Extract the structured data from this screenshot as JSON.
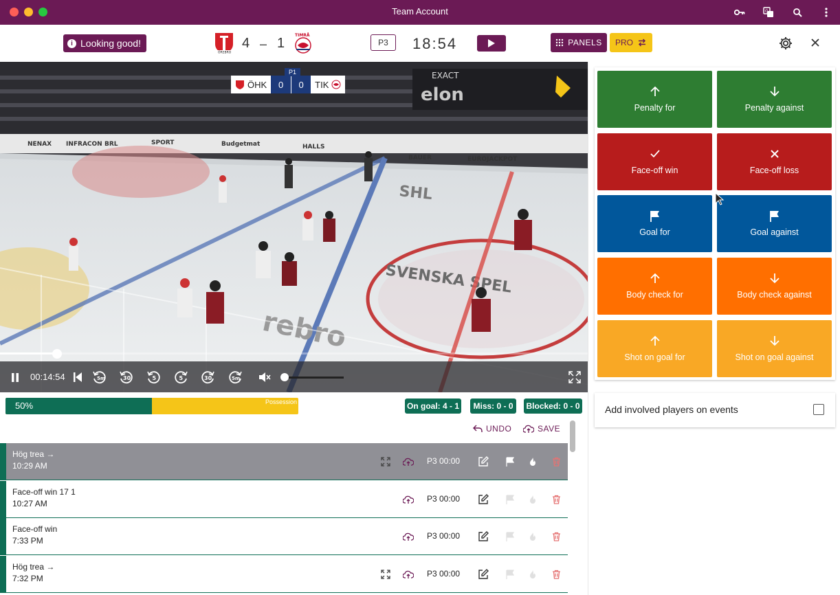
{
  "window": {
    "title": "Team Account"
  },
  "header": {
    "status": "Looking good!",
    "home_score": "4",
    "dash": "–",
    "away_score": "1",
    "period": "P3",
    "clock": "18:54",
    "panels_label": "PANELS",
    "pro_label": "PRO"
  },
  "video": {
    "scorebug": {
      "home": "ÖHK",
      "home_goals": "0",
      "away_goals": "0",
      "away": "TIK",
      "period": "P1"
    },
    "current_time": "00:14:54",
    "progress": 0.097
  },
  "stats": {
    "possession_pct": "50%",
    "possession_value": 0.5,
    "possession_label": "Possession",
    "on_goal": "On goal: 4 - 1",
    "miss": "Miss: 0 - 0",
    "blocked": "Blocked: 0 - 0"
  },
  "toolbar": {
    "undo": "UNDO",
    "save": "SAVE"
  },
  "events": [
    {
      "name": "Hög trea →",
      "time": "10:29 AM",
      "period": "P3 00:00"
    },
    {
      "name": "Face-off win  17   1",
      "time": "10:27 AM",
      "period": "P3 00:00"
    },
    {
      "name": "Face-off win",
      "time": "7:33 PM",
      "period": "P3 00:00"
    },
    {
      "name": "Hög trea →",
      "time": "7:32 PM",
      "period": "P3 00:00"
    }
  ],
  "actions": [
    {
      "label": "Penalty for",
      "icon": "arrow-up-icon",
      "color": "#2e7d32"
    },
    {
      "label": "Penalty against",
      "icon": "arrow-down-icon",
      "color": "#2e7d32"
    },
    {
      "label": "Face-off win",
      "icon": "check-icon",
      "color": "#b71c1c"
    },
    {
      "label": "Face-off loss",
      "icon": "x-icon",
      "color": "#b71c1c"
    },
    {
      "label": "Goal for",
      "icon": "flag-icon",
      "color": "#01579b"
    },
    {
      "label": "Goal against",
      "icon": "flag-icon",
      "color": "#01579b"
    },
    {
      "label": "Body check for",
      "icon": "arrow-up-icon",
      "color": "#ff6f00"
    },
    {
      "label": "Body check against",
      "icon": "arrow-down-icon",
      "color": "#ff6f00"
    },
    {
      "label": "Shot on goal for",
      "icon": "arrow-up-icon",
      "color": "#f9a825"
    },
    {
      "label": "Shot on goal against",
      "icon": "arrow-down-icon",
      "color": "#f9a825"
    }
  ],
  "involved": {
    "label": "Add involved players on events",
    "checked": false
  },
  "colors": {
    "brand": "#6b1a55",
    "accent": "#f5c518",
    "stat_green": "#0e6e55"
  }
}
